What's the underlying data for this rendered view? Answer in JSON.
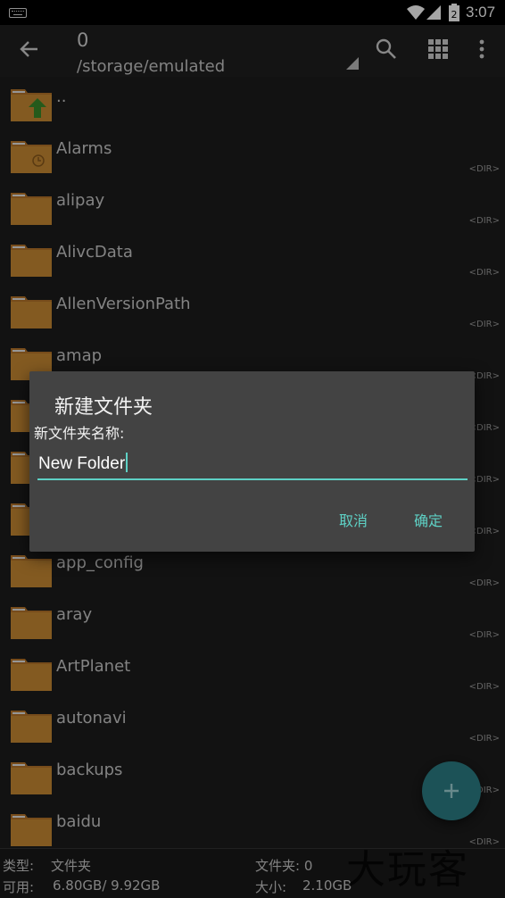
{
  "status_bar": {
    "time": "3:07",
    "battery_level": "2"
  },
  "toolbar": {
    "title": "0",
    "path": "/storage/emulated"
  },
  "files": [
    {
      "name": "..",
      "type": ""
    },
    {
      "name": "Alarms",
      "type": "<DIR>"
    },
    {
      "name": "alipay",
      "type": "<DIR>"
    },
    {
      "name": "AlivcData",
      "type": "<DIR>"
    },
    {
      "name": "AllenVersionPath",
      "type": "<DIR>"
    },
    {
      "name": "amap",
      "type": "<DIR>"
    },
    {
      "name": "",
      "type": "<DIR>"
    },
    {
      "name": "",
      "type": "<DIR>"
    },
    {
      "name": "",
      "type": "<DIR>"
    },
    {
      "name": "app_config",
      "type": "<DIR>"
    },
    {
      "name": "aray",
      "type": "<DIR>"
    },
    {
      "name": "ArtPlanet",
      "type": "<DIR>"
    },
    {
      "name": "autonavi",
      "type": "<DIR>"
    },
    {
      "name": "backups",
      "type": "<DIR>"
    },
    {
      "name": "baidu",
      "type": "<DIR>"
    }
  ],
  "dialog": {
    "title": "新建文件夹",
    "label": "新文件夹名称:",
    "input_value": "New Folder",
    "cancel": "取消",
    "confirm": "确定"
  },
  "footer": {
    "type_label": "类型:",
    "type_value": "文件夹",
    "available_label": "可用:",
    "available_value": "6.80GB/ 9.92GB",
    "folders_label": "文件夹: 0",
    "size_label": "大小:",
    "size_value": "2.10GB"
  },
  "watermark": "大玩客",
  "colors": {
    "accent": "#5ed1c5",
    "folder": "#b7762a",
    "fab": "#2c7f86"
  }
}
